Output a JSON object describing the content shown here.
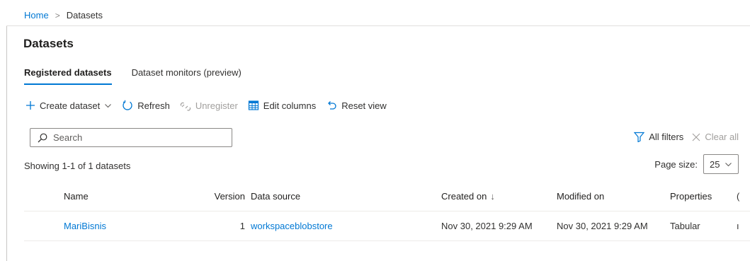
{
  "breadcrumb": {
    "home": "Home",
    "separator": ">",
    "current": "Datasets"
  },
  "page": {
    "title": "Datasets"
  },
  "tabs": [
    {
      "label": "Registered datasets",
      "active": true
    },
    {
      "label": "Dataset monitors (preview)",
      "active": false
    }
  ],
  "toolbar": {
    "create_label": "Create dataset",
    "refresh_label": "Refresh",
    "unregister_label": "Unregister",
    "edit_columns_label": "Edit columns",
    "reset_view_label": "Reset view"
  },
  "search": {
    "placeholder": "Search",
    "value": ""
  },
  "filters": {
    "all_filters_label": "All filters",
    "clear_all_label": "Clear all"
  },
  "summary": {
    "showing_text": "Showing 1-1 of 1 datasets"
  },
  "pagination": {
    "page_size_label": "Page size:",
    "page_size_value": "25"
  },
  "table": {
    "columns": {
      "name": "Name",
      "version": "Version",
      "data_source": "Data source",
      "created_on": "Created on",
      "modified_on": "Modified on",
      "properties": "Properties"
    },
    "sorted_column": "created_on",
    "sort_direction": "descending",
    "rows": [
      {
        "name": "MariBisnis",
        "version": "1",
        "data_source": "workspaceblobstore",
        "created_on": "Nov 30, 2021 9:29 AM",
        "modified_on": "Nov 30, 2021 9:29 AM",
        "properties": "Tabular"
      }
    ]
  },
  "colors": {
    "accent": "#0078d4",
    "text": "#323130",
    "disabled": "#a19f9d",
    "border": "#8a8886"
  }
}
